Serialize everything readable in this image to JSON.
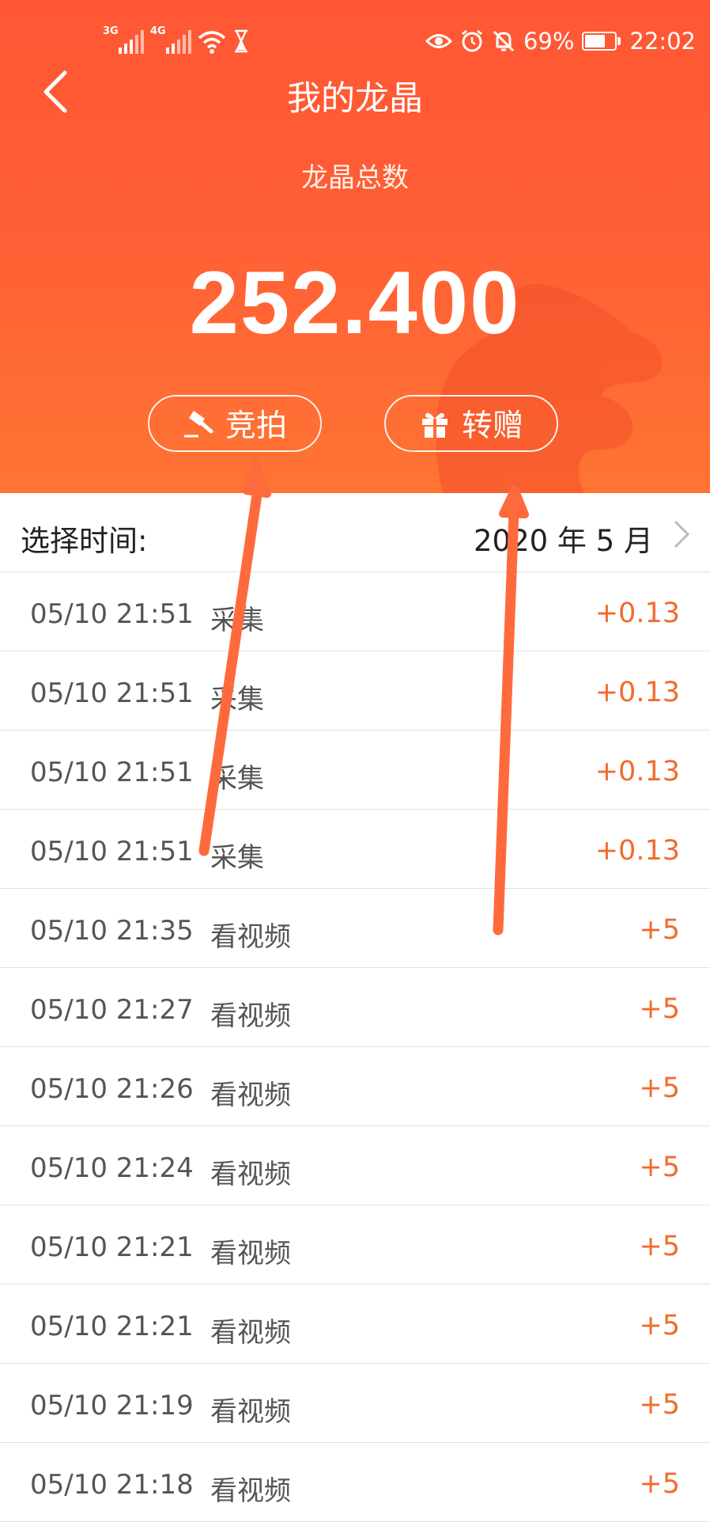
{
  "status_bar": {
    "signal_1_label": "3G",
    "signal_2_label": "4G",
    "battery_percent": "69%",
    "battery_level": 0.69,
    "time": "22:02"
  },
  "header": {
    "title": "我的龙晶",
    "total_label": "龙晶总数",
    "total_value": "252.400"
  },
  "actions": {
    "auction_label": "竞拍",
    "transfer_label": "转赠"
  },
  "time_filter": {
    "label": "选择时间:",
    "value": "2020 年 5 月"
  },
  "records": [
    {
      "time": "05/10 21:51",
      "type": "采集",
      "amount": "+0.13"
    },
    {
      "time": "05/10 21:51",
      "type": "采集",
      "amount": "+0.13"
    },
    {
      "time": "05/10 21:51",
      "type": "采集",
      "amount": "+0.13"
    },
    {
      "time": "05/10 21:51",
      "type": "采集",
      "amount": "+0.13"
    },
    {
      "time": "05/10 21:35",
      "type": "看视频",
      "amount": "+5"
    },
    {
      "time": "05/10 21:27",
      "type": "看视频",
      "amount": "+5"
    },
    {
      "time": "05/10 21:26",
      "type": "看视频",
      "amount": "+5"
    },
    {
      "time": "05/10 21:24",
      "type": "看视频",
      "amount": "+5"
    },
    {
      "time": "05/10 21:21",
      "type": "看视频",
      "amount": "+5"
    },
    {
      "time": "05/10 21:21",
      "type": "看视频",
      "amount": "+5"
    },
    {
      "time": "05/10 21:19",
      "type": "看视频",
      "amount": "+5"
    },
    {
      "time": "05/10 21:18",
      "type": "看视频",
      "amount": "+5"
    }
  ],
  "colors": {
    "header_top": "#FF5734",
    "header_bottom": "#FF7433",
    "amount": "#F26B2C",
    "annotation_arrow": "#FF6A3D"
  },
  "icons": {
    "back": "chevron-left-icon",
    "auction": "gavel-icon",
    "transfer": "gift-icon",
    "time_picker": "chevron-right-icon"
  }
}
